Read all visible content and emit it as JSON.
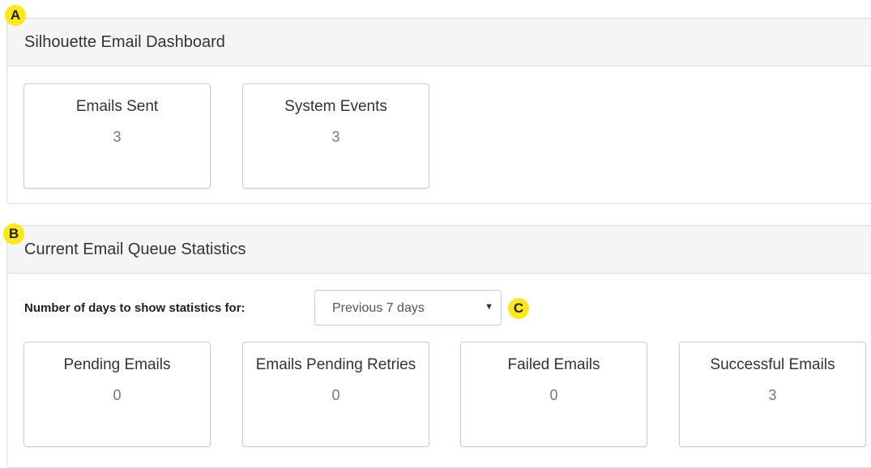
{
  "dashboard": {
    "title": "Silhouette Email Dashboard",
    "cards": [
      {
        "label": "Emails Sent",
        "value": "3"
      },
      {
        "label": "System Events",
        "value": "3"
      }
    ]
  },
  "queue": {
    "title": "Current Email Queue Statistics",
    "filter_label": "Number of days to show statistics for:",
    "filter_selected": "Previous 7 days",
    "cards": [
      {
        "label": "Pending Emails",
        "value": "0"
      },
      {
        "label": "Emails Pending Retries",
        "value": "0"
      },
      {
        "label": "Failed Emails",
        "value": "0"
      },
      {
        "label": "Successful Emails",
        "value": "3"
      }
    ]
  },
  "markers": {
    "a": "A",
    "b": "B",
    "c": "C"
  },
  "colors": {
    "marker": "#ffe819",
    "panel_heading_bg": "#f5f5f5",
    "border": "#dddddd"
  }
}
